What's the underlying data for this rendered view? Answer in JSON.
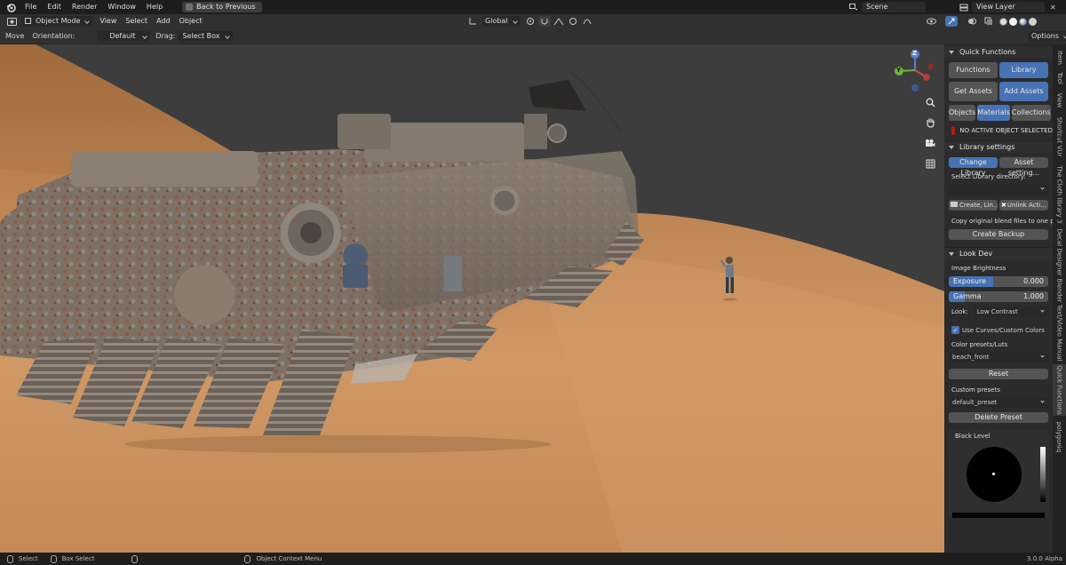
{
  "menubar": {
    "items": [
      "File",
      "Edit",
      "Render",
      "Window",
      "Help"
    ],
    "back_button": "Back to Previous",
    "scene": "Scene",
    "view_layer": "View Layer"
  },
  "header": {
    "mode": "Object Mode",
    "menus": [
      "View",
      "Select",
      "Add",
      "Object"
    ],
    "transform_orientation": "Global"
  },
  "toolrow": {
    "tool": "Move",
    "orientation_label": "Orientation:",
    "orientation_value": "Default",
    "drag_label": "Drag:",
    "drag_value": "Select Box",
    "options": "Options"
  },
  "gizmo": {
    "z": "Z",
    "y": "Y"
  },
  "npanel": {
    "quick_functions": {
      "title": "Quick Functions",
      "functions": "Functions",
      "library": "Library",
      "get_assets": "Get Assets",
      "add_assets": "Add Assets",
      "objects": "Objects",
      "materials": "Materials",
      "collections": "Collections",
      "warning": "NO ACTIVE OBJECT SELECTED"
    },
    "library_settings": {
      "title": "Library settings",
      "change_library": "Change Library",
      "asset_setting": "Asset setting...",
      "select_dir": "Select Library directory:",
      "create_link": "Create, Lin...",
      "unlink_active": "Unlink Acti...",
      "copy_text": "Copy original blend files to one pl...",
      "create_backup": "Create Backup"
    },
    "look_dev": {
      "title": "Look Dev",
      "image_brightness": "Image Brightness",
      "exposure_label": "Exposure",
      "exposure_value": "0.000",
      "exposure_fill": 0.45,
      "gamma_label": "Gamma",
      "gamma_value": "1.000",
      "gamma_fill": 0.16,
      "look_label": "Look:",
      "look_value": "Low Contrast",
      "use_curves": "Use Curves/Custom Colors",
      "use_curves_checked": true,
      "color_presets": "Color presets/Luts",
      "color_preset_value": "beach_front",
      "reset": "Reset",
      "custom_presets": "Custom presets",
      "custom_preset_value": "default_preset",
      "delete_preset": "Delete Preset",
      "black_level": "Black Level"
    }
  },
  "vtabs": [
    "Item",
    "Tool",
    "View",
    "Shortcut VUr",
    "The Cloth library 3",
    "Decal Designer",
    "Blender Text/Video Manual",
    "Quick Functions",
    "polygoniq"
  ],
  "statusbar": {
    "select": "Select",
    "box_select": "Box Select",
    "context_menu": "Object Context Menu",
    "version": "3.0.0 Alpha"
  },
  "colors": {
    "accent": "#4772b3",
    "sand": "#c9905a",
    "sky": "#3d3d3d",
    "warning_swatch": "#b31919"
  }
}
